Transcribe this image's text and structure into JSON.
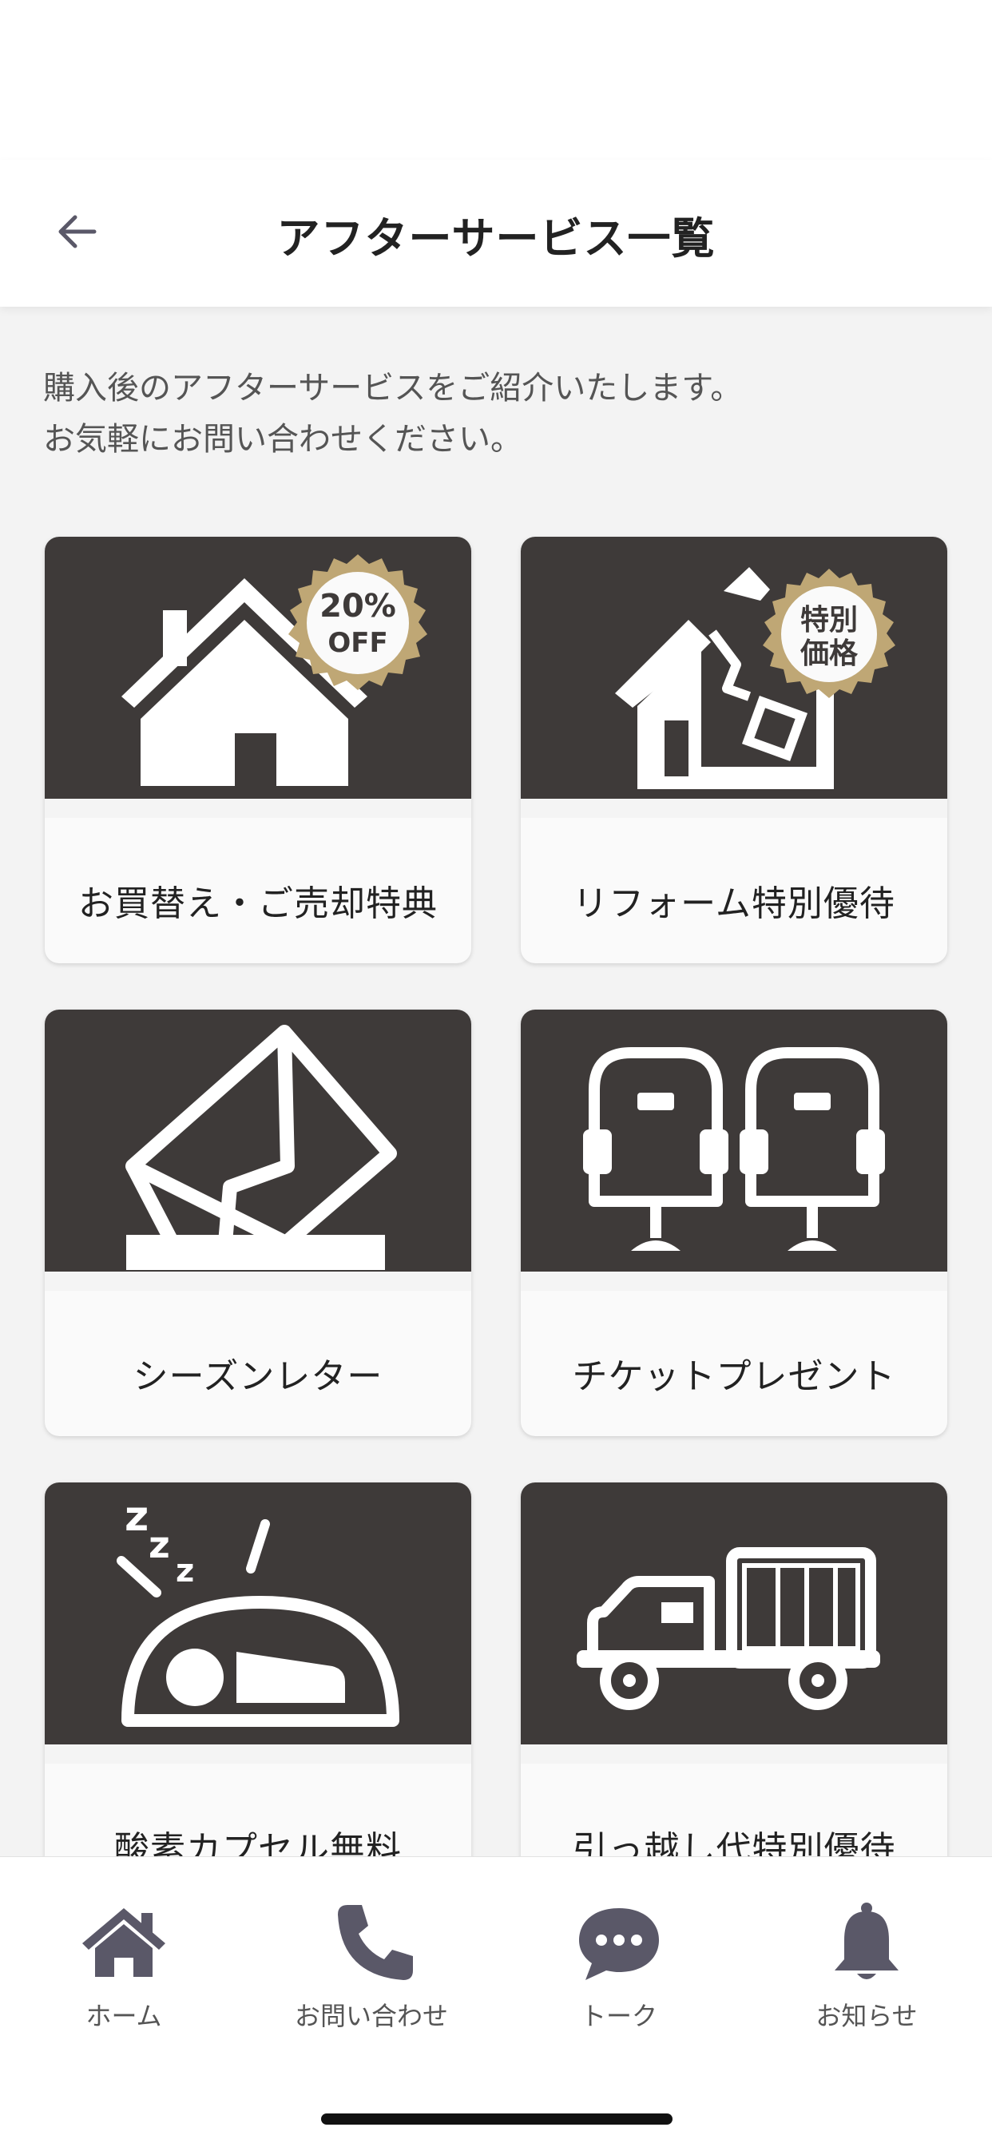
{
  "header": {
    "title": "アフターサービス一覧",
    "back_icon": "arrow-left-icon"
  },
  "intro": {
    "line1": "購入後のアフターサービスをご紹介いたします。",
    "line2": "お気軽にお問い合わせください。"
  },
  "services": [
    {
      "label": "お買替え・ご売却特典",
      "icon": "house-icon",
      "badge_line1": "20%",
      "badge_line2": "OFF"
    },
    {
      "label": "リフォーム特別優待",
      "icon": "broken-house-icon",
      "badge_line1": "特別",
      "badge_line2": "価格"
    },
    {
      "label": "シーズンレター",
      "icon": "envelope-icon"
    },
    {
      "label": "チケットプレゼント",
      "icon": "theater-seats-icon"
    },
    {
      "label": "酸素カプセル無料",
      "icon": "oxygen-capsule-icon"
    },
    {
      "label": "引っ越し代特別優待",
      "icon": "moving-truck-icon"
    }
  ],
  "tabs": [
    {
      "label": "ホーム",
      "icon": "home-icon"
    },
    {
      "label": "お問い合わせ",
      "icon": "phone-icon"
    },
    {
      "label": "トーク",
      "icon": "chat-bubble-icon"
    },
    {
      "label": "お知らせ",
      "icon": "bell-icon"
    }
  ],
  "colors": {
    "card_image_bg": "#3e3a39",
    "badge_gold": "#bfa775",
    "icon_gray": "#5a5868",
    "background": "#f3f3f3"
  }
}
